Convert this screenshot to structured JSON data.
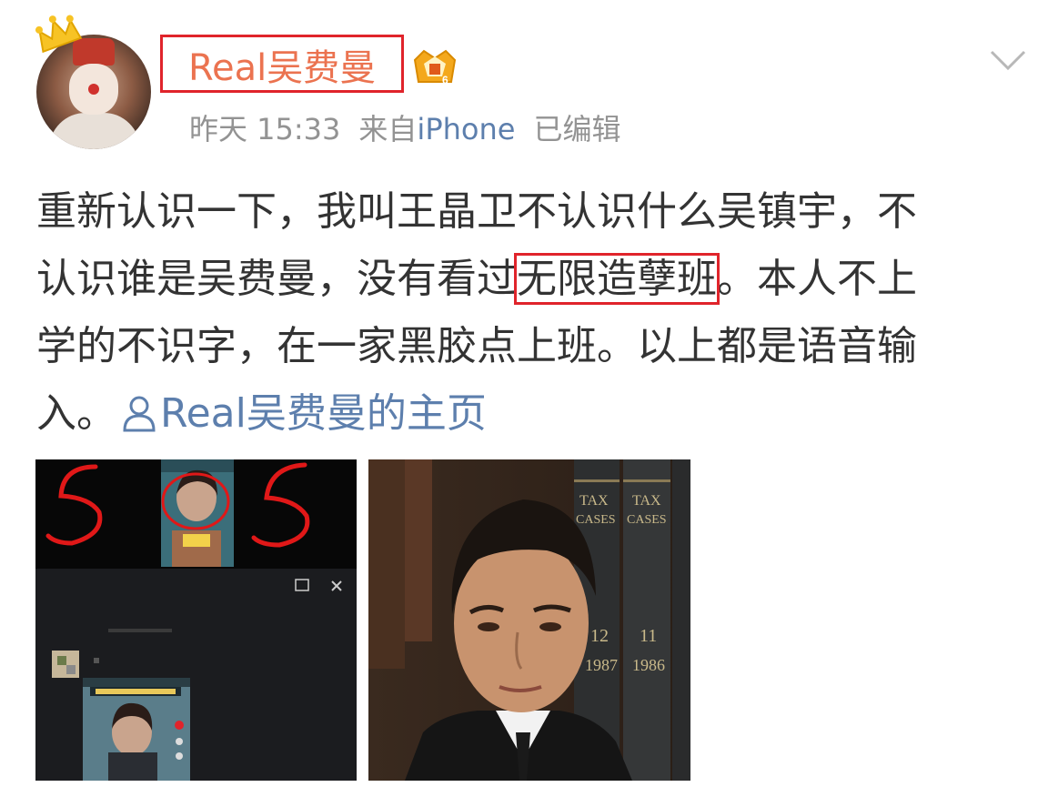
{
  "post": {
    "username": "Real吴费曼",
    "time": "昨天 15:33",
    "source_prefix": "来自",
    "source": "iPhone",
    "edited": "已编辑",
    "text_lines": [
      {
        "before": "重新认识一下，我叫王晶卫不认识什么吴镇宇，不",
        "highlight": "",
        "after": ""
      },
      {
        "before": "认识谁是吴费曼，没有看过",
        "highlight": "无限造孽班",
        "after": "。本人不上"
      },
      {
        "before": "学的不识字，在一家黑胶点上班。以上都是语音输",
        "highlight": "",
        "after": ""
      }
    ],
    "last_line_text": "入。",
    "homepage_link": "Real吴费曼的主页"
  },
  "icons": {
    "avatar": "avatar-image",
    "crown": "crown-icon",
    "vip": "vip-badge-icon",
    "chevron": "chevron-down-icon",
    "person": "person-icon"
  },
  "colors": {
    "username": "#eb7350",
    "link": "#5d7fad",
    "meta": "#939393",
    "highlight_box": "#e0242b"
  },
  "images": [
    {
      "name": "screenshot-collage-image"
    },
    {
      "name": "tv-drama-still-image"
    }
  ]
}
